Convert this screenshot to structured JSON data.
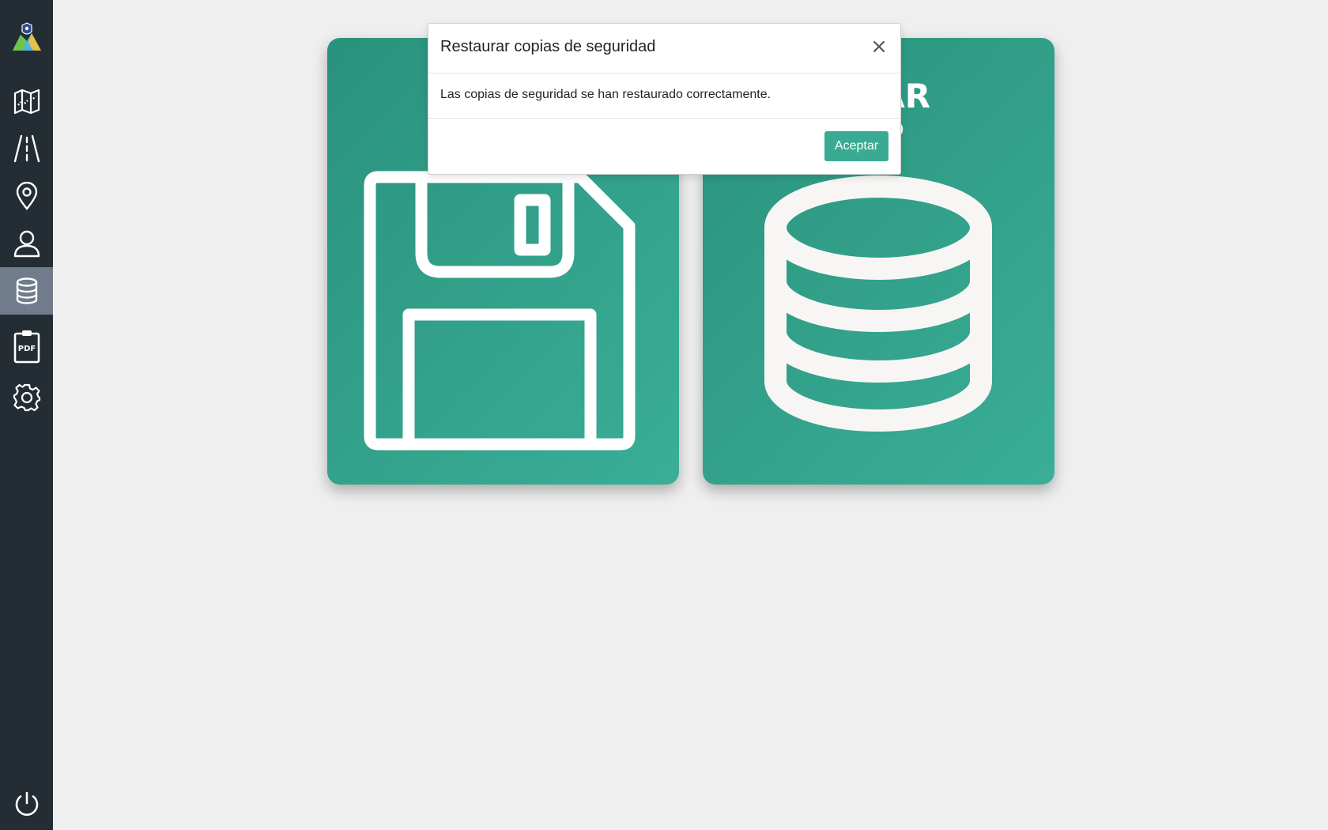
{
  "sidebar": {
    "items": [
      {
        "id": "map",
        "icon": "map-icon",
        "active": false
      },
      {
        "id": "roads",
        "icon": "road-icon",
        "active": false
      },
      {
        "id": "locations",
        "icon": "map-pin-icon",
        "active": false
      },
      {
        "id": "users",
        "icon": "user-icon",
        "active": false
      },
      {
        "id": "backups",
        "icon": "database-icon",
        "active": true
      },
      {
        "id": "reports",
        "icon": "pdf-clipboard-icon",
        "label": "PDF",
        "active": false
      },
      {
        "id": "settings",
        "icon": "gear-icon",
        "active": false
      }
    ],
    "logout_icon": "power-icon"
  },
  "cards": {
    "left": {
      "icon": "floppy-disk-icon",
      "title": ""
    },
    "right": {
      "icon": "database-icon",
      "title": "URAR\nUP"
    }
  },
  "modal": {
    "title": "Restaurar copias de seguridad",
    "close_symbol": "×",
    "message": "Las copias de seguridad se han restaurado correctamente.",
    "accept_label": "Aceptar"
  },
  "colors": {
    "sidebar_bg": "#242d33",
    "sidebar_active": "#707c8c",
    "card_green": "#3aae97",
    "accent_button": "#3aab93",
    "page_bg": "#efefef"
  }
}
